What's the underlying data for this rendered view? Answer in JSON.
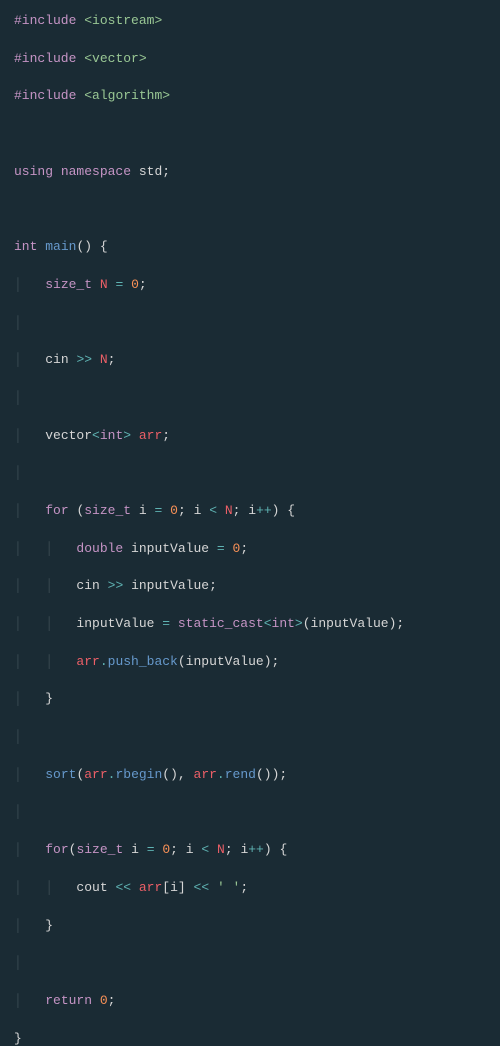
{
  "code": {
    "l1_pp": "#include",
    "l1_inc": "<iostream>",
    "l2_pp": "#include",
    "l2_inc": "<vector>",
    "l3_pp": "#include",
    "l3_inc": "<algorithm>",
    "l5_using": "using",
    "l5_ns": "namespace",
    "l5_std": "std",
    "l5_semi": ";",
    "l7_int": "int",
    "l7_main": "main",
    "l7_paren": "()",
    "l7_brace": " {",
    "l8_type": "size_t",
    "l8_var": "N",
    "l8_eq": "=",
    "l8_val": "0",
    "l8_semi": ";",
    "l10_cin": "cin",
    "l10_op": ">>",
    "l10_var": "N",
    "l10_semi": ";",
    "l12_vec": "vector",
    "l12_lt": "<",
    "l12_int": "int",
    "l12_gt": ">",
    "l12_arr": "arr",
    "l12_semi": ";",
    "l14_for": "for",
    "l14_open": "(",
    "l14_type": "size_t",
    "l14_i": "i",
    "l14_eq": "=",
    "l14_z": "0",
    "l14_s1": ";",
    "l14_i2": "i",
    "l14_lt": "<",
    "l14_N": "N",
    "l14_s2": ";",
    "l14_i3": "i",
    "l14_pp": "++",
    "l14_close": ")",
    "l14_brace": " {",
    "l15_type": "double",
    "l15_var": "inputValue",
    "l15_eq": "=",
    "l15_val": "0",
    "l15_semi": ";",
    "l16_cin": "cin",
    "l16_op": ">>",
    "l16_var": "inputValue",
    "l16_semi": ";",
    "l17_var": "inputValue",
    "l17_eq": "=",
    "l17_cast": "static_cast",
    "l17_lt": "<",
    "l17_int": "int",
    "l17_gt": ">",
    "l17_open": "(",
    "l17_arg": "inputValue",
    "l17_close": ")",
    "l17_semi": ";",
    "l18_arr": "arr",
    "l18_dot": ".",
    "l18_fn": "push_back",
    "l18_open": "(",
    "l18_arg": "inputValue",
    "l18_close": ")",
    "l18_semi": ";",
    "l19_brace": "}",
    "l21_sort": "sort",
    "l21_open": "(",
    "l21_arr1": "arr",
    "l21_dot1": ".",
    "l21_rb": "rbegin",
    "l21_p1": "()",
    "l21_comma": ",",
    "l21_arr2": "arr",
    "l21_dot2": ".",
    "l21_re": "rend",
    "l21_p2": "()",
    "l21_close": ")",
    "l21_semi": ";",
    "l23_for": "for",
    "l23_open": "(",
    "l23_type": "size_t",
    "l23_i": "i",
    "l23_eq": "=",
    "l23_z": "0",
    "l23_s1": ";",
    "l23_i2": "i",
    "l23_lt": "<",
    "l23_N": "N",
    "l23_s2": ";",
    "l23_i3": "i",
    "l23_pp": "++",
    "l23_close": ")",
    "l23_brace": " {",
    "l24_cout": "cout",
    "l24_op1": "<<",
    "l24_arr": "arr",
    "l24_br1": "[",
    "l24_i": "i",
    "l24_br2": "]",
    "l24_op2": "<<",
    "l24_ch": "' '",
    "l24_semi": ";",
    "l25_brace": "}",
    "l27_ret": "return",
    "l27_val": "0",
    "l27_semi": ";",
    "l28_brace": "}"
  }
}
